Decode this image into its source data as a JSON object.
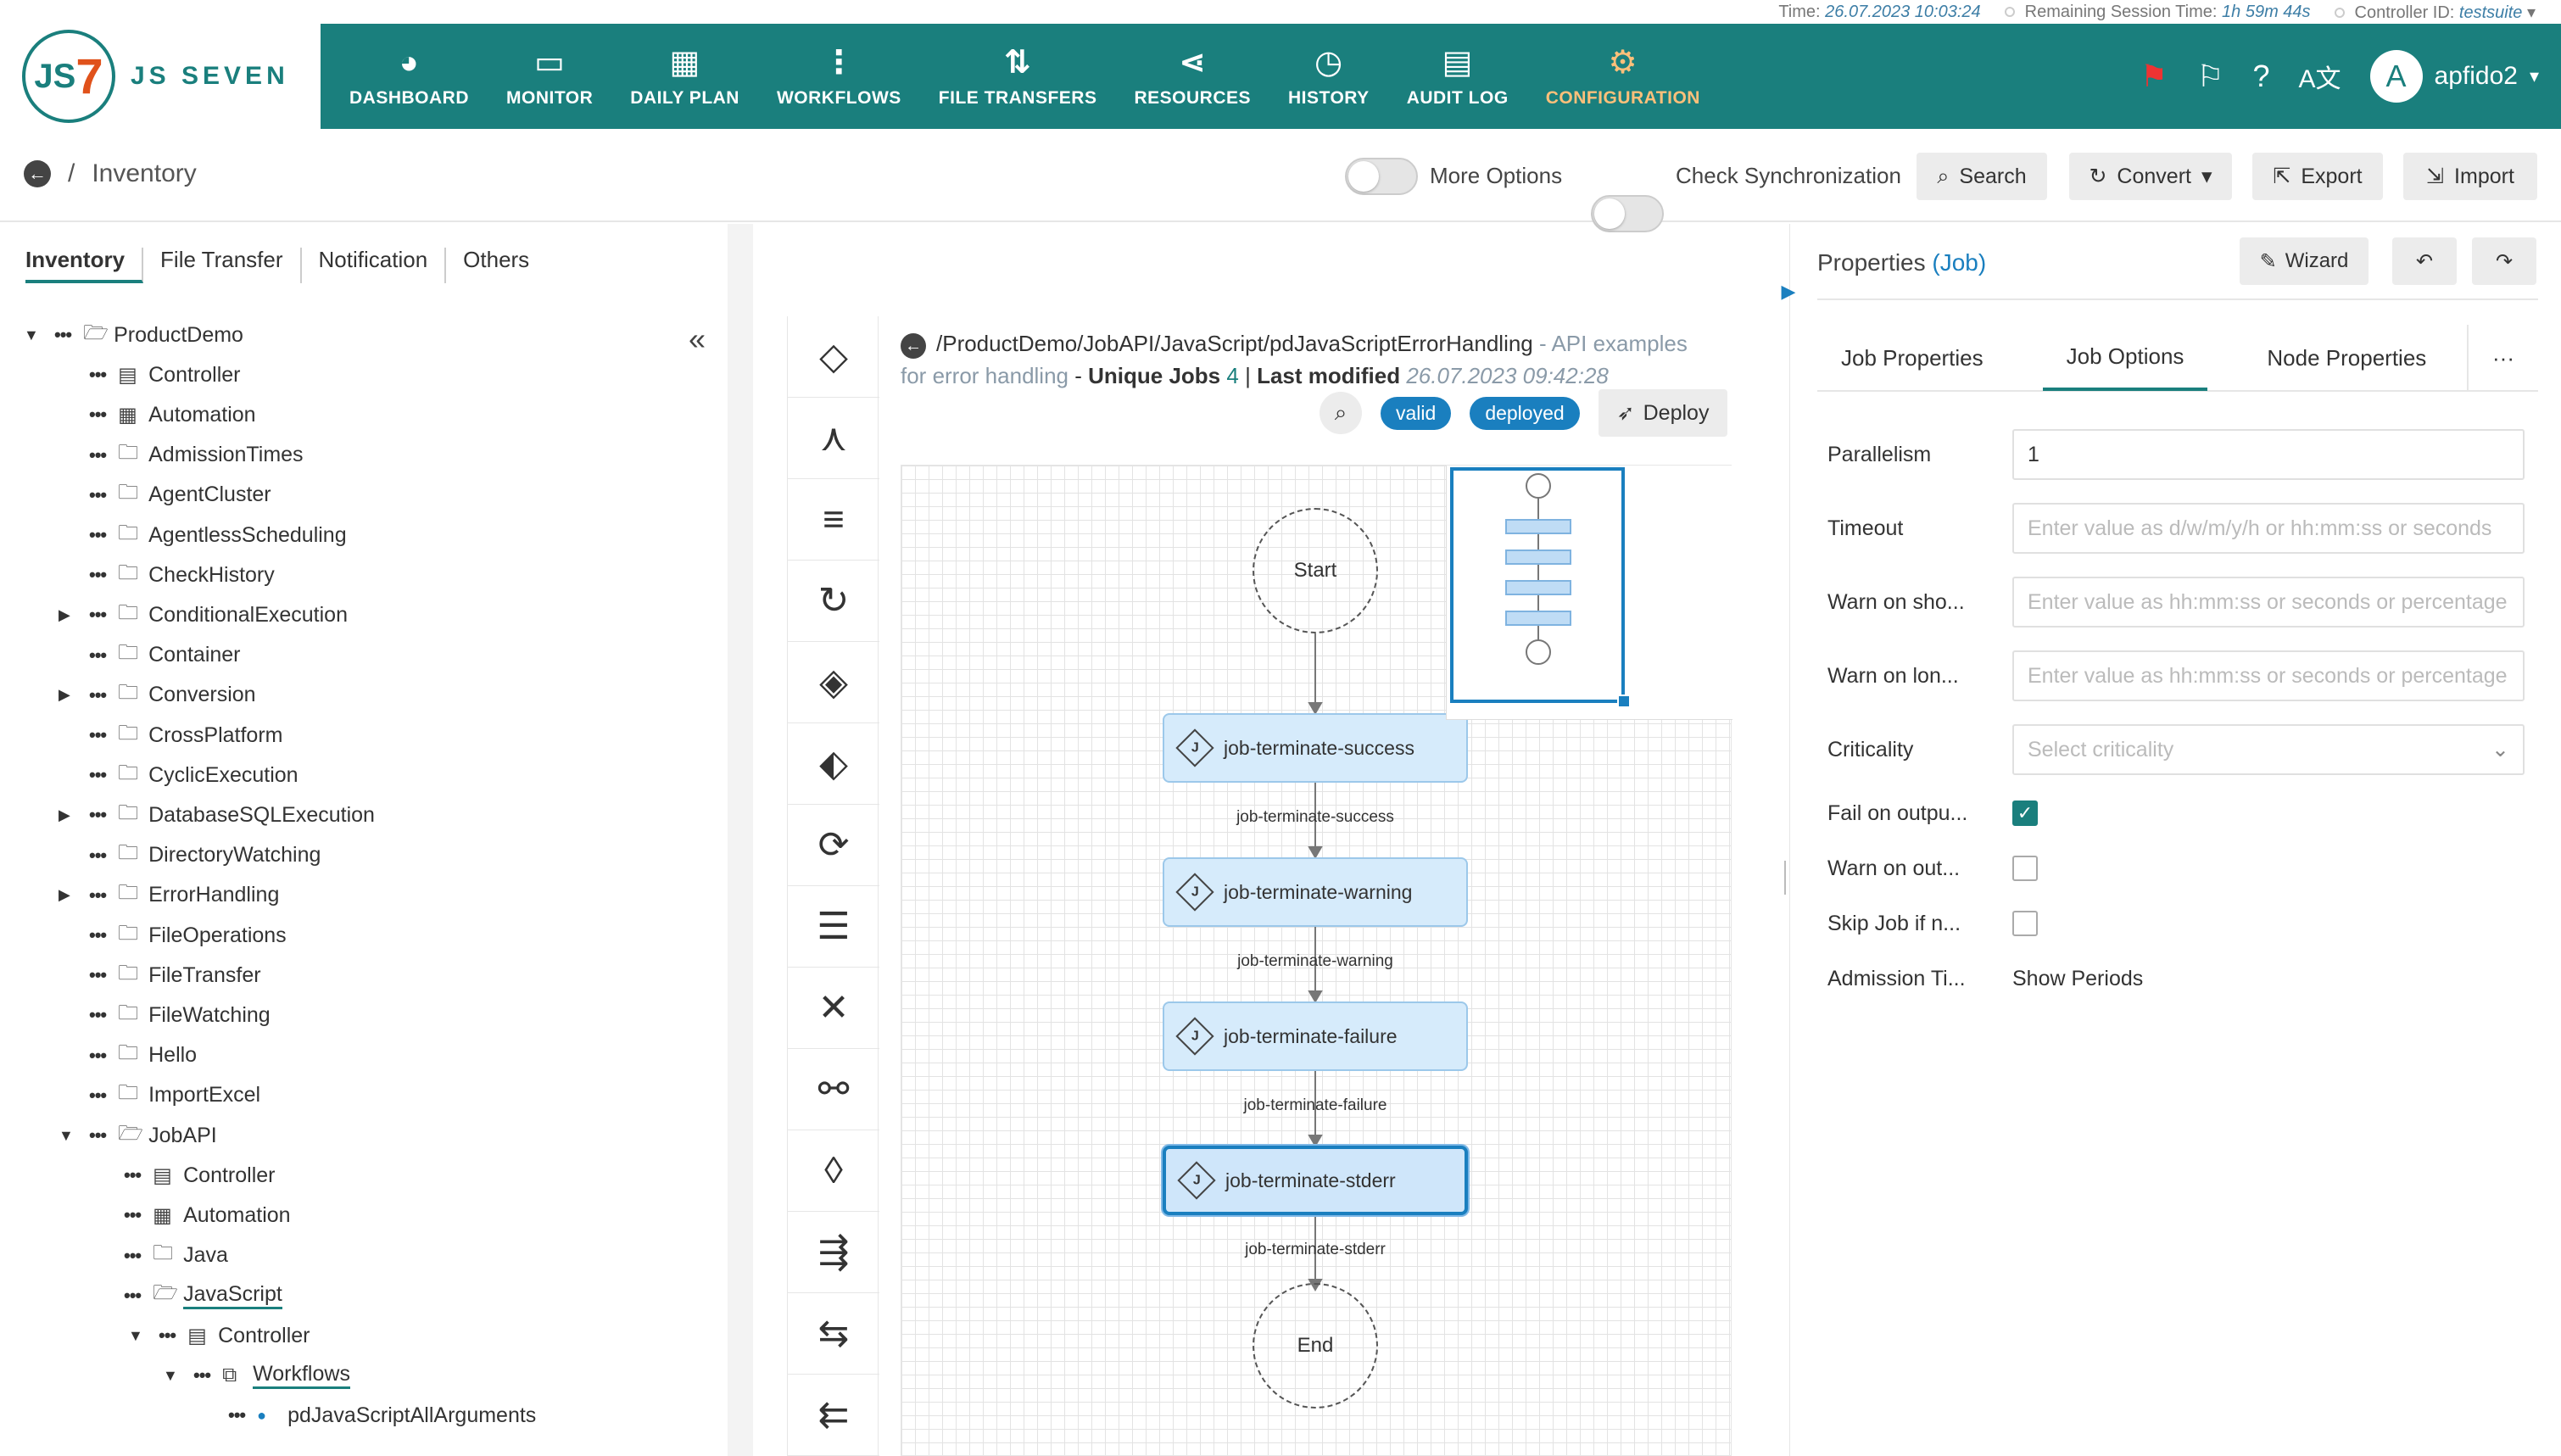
{
  "status_bar": {
    "time_label": "Time:",
    "time_value": "26.07.2023 10:03:24",
    "session_label": "Remaining Session Time:",
    "session_value": "1h 59m 44s",
    "controller_label": "Controller ID:",
    "controller_value": "testsuite"
  },
  "header": {
    "logo_text": "JS SEVEN",
    "logo_mark": "JS",
    "nav": [
      {
        "label": "DASHBOARD",
        "icon": "dashboard-icon",
        "glyph": "◕"
      },
      {
        "label": "MONITOR",
        "icon": "monitor-icon",
        "glyph": "▭"
      },
      {
        "label": "DAILY PLAN",
        "icon": "calendar-clock-icon",
        "glyph": "▦"
      },
      {
        "label": "WORKFLOWS",
        "icon": "workflow-icon",
        "glyph": "⋮"
      },
      {
        "label": "FILE TRANSFERS",
        "icon": "transfer-icon",
        "glyph": "⇅"
      },
      {
        "label": "RESOURCES",
        "icon": "share-icon",
        "glyph": "⋖"
      },
      {
        "label": "HISTORY",
        "icon": "alarm-icon",
        "glyph": "◷"
      },
      {
        "label": "AUDIT LOG",
        "icon": "file-search-icon",
        "glyph": "▤"
      },
      {
        "label": "CONFIGURATION",
        "icon": "gear-icon",
        "glyph": "⚙",
        "active": true
      }
    ],
    "user_initial": "A",
    "user_name": "apfido2"
  },
  "toolbar": {
    "breadcrumb": "Inventory",
    "more_options": "More Options",
    "check_sync": "Check Synchronization",
    "search": "Search",
    "convert": "Convert",
    "export": "Export",
    "import": "Import"
  },
  "left_tabs": [
    "Inventory",
    "File Transfer",
    "Notification",
    "Others"
  ],
  "tree": [
    {
      "label": "ProductDemo",
      "icon": "folder-open",
      "level": 0,
      "toggle": "▼"
    },
    {
      "label": "Controller",
      "icon": "doc",
      "level": 1,
      "toggle": ""
    },
    {
      "label": "Automation",
      "icon": "calendar",
      "level": 1,
      "toggle": ""
    },
    {
      "label": "AdmissionTimes",
      "icon": "folder",
      "level": 1,
      "toggle": ""
    },
    {
      "label": "AgentCluster",
      "icon": "folder",
      "level": 1,
      "toggle": ""
    },
    {
      "label": "AgentlessScheduling",
      "icon": "folder",
      "level": 1,
      "toggle": ""
    },
    {
      "label": "CheckHistory",
      "icon": "folder",
      "level": 1,
      "toggle": ""
    },
    {
      "label": "ConditionalExecution",
      "icon": "folder",
      "level": 1,
      "toggle": "▶"
    },
    {
      "label": "Container",
      "icon": "folder",
      "level": 1,
      "toggle": ""
    },
    {
      "label": "Conversion",
      "icon": "folder",
      "level": 1,
      "toggle": "▶"
    },
    {
      "label": "CrossPlatform",
      "icon": "folder",
      "level": 1,
      "toggle": ""
    },
    {
      "label": "CyclicExecution",
      "icon": "folder",
      "level": 1,
      "toggle": ""
    },
    {
      "label": "DatabaseSQLExecution",
      "icon": "folder",
      "level": 1,
      "toggle": "▶"
    },
    {
      "label": "DirectoryWatching",
      "icon": "folder",
      "level": 1,
      "toggle": ""
    },
    {
      "label": "ErrorHandling",
      "icon": "folder",
      "level": 1,
      "toggle": "▶"
    },
    {
      "label": "FileOperations",
      "icon": "folder",
      "level": 1,
      "toggle": ""
    },
    {
      "label": "FileTransfer",
      "icon": "folder",
      "level": 1,
      "toggle": ""
    },
    {
      "label": "FileWatching",
      "icon": "folder",
      "level": 1,
      "toggle": ""
    },
    {
      "label": "Hello",
      "icon": "folder",
      "level": 1,
      "toggle": ""
    },
    {
      "label": "ImportExcel",
      "icon": "folder",
      "level": 1,
      "toggle": ""
    },
    {
      "label": "JobAPI",
      "icon": "folder-open",
      "level": 1,
      "toggle": "▼"
    },
    {
      "label": "Controller",
      "icon": "doc",
      "level": 2,
      "toggle": ""
    },
    {
      "label": "Automation",
      "icon": "calendar",
      "level": 2,
      "toggle": ""
    },
    {
      "label": "Java",
      "icon": "folder",
      "level": 2,
      "toggle": ""
    },
    {
      "label": "JavaScript",
      "icon": "folder-open",
      "level": 2,
      "toggle": "",
      "selected": true
    },
    {
      "label": "Controller",
      "icon": "doc",
      "level": 3,
      "toggle": "▼"
    },
    {
      "label": "Workflows",
      "icon": "workflow",
      "level": 4,
      "toggle": "▼",
      "selected": true
    },
    {
      "label": "pdJavaScriptAllArguments",
      "icon": "dot",
      "level": 5,
      "toggle": ""
    }
  ],
  "workflow": {
    "path": "/ProductDemo/JobAPI/JavaScript/pdJavaScriptErrorHandling",
    "title": "API examples for error handling",
    "unique_jobs_label": "Unique Jobs",
    "unique_jobs_count": "4",
    "last_modified_label": "Last modified",
    "last_modified_value": "26.07.2023 09:42:28",
    "badge_valid": "valid",
    "badge_deployed": "deployed",
    "deploy_label": "Deploy",
    "start_label": "Start",
    "end_label": "End",
    "jobs": [
      {
        "name": "job-terminate-success",
        "edge": "job-terminate-success"
      },
      {
        "name": "job-terminate-warning",
        "edge": "job-terminate-warning"
      },
      {
        "name": "job-terminate-failure",
        "edge": "job-terminate-failure"
      },
      {
        "name": "job-terminate-stderr",
        "edge": "job-terminate-stderr",
        "selected": true
      }
    ]
  },
  "palette": [
    {
      "name": "job-instruction",
      "glyph": "◇"
    },
    {
      "name": "fork-instruction",
      "glyph": "⋏"
    },
    {
      "name": "fork-list-instruction",
      "glyph": "≡"
    },
    {
      "name": "retry-instruction",
      "glyph": "↻"
    },
    {
      "name": "if-instruction",
      "glyph": "◈"
    },
    {
      "name": "try-instruction",
      "glyph": "⬖"
    },
    {
      "name": "cycle-instruction",
      "glyph": "⟳"
    },
    {
      "name": "finish-instruction",
      "glyph": "☰"
    },
    {
      "name": "fail-instruction",
      "glyph": "✕"
    },
    {
      "name": "lock-instruction",
      "glyph": "⚯"
    },
    {
      "name": "prompt-instruction",
      "glyph": "◊"
    },
    {
      "name": "post-notice-instruction",
      "glyph": "⇶"
    },
    {
      "name": "expect-notice-instruction",
      "glyph": "⇆"
    },
    {
      "name": "consume-notice-instruction",
      "glyph": "⇇"
    }
  ],
  "properties": {
    "title": "Properties",
    "title_type": "(Job)",
    "wizard": "Wizard",
    "tabs": [
      "Job Properties",
      "Job Options",
      "Node Properties"
    ],
    "more_tab": "···",
    "fields": {
      "parallelism_label": "Parallelism",
      "parallelism_value": "1",
      "timeout_label": "Timeout",
      "timeout_placeholder": "Enter value as d/w/m/y/h or hh:mm:ss or seconds",
      "warn_short_label": "Warn on sho...",
      "warn_short_placeholder": "Enter value as hh:mm:ss or seconds or percentage",
      "warn_long_label": "Warn on lon...",
      "warn_long_placeholder": "Enter value as hh:mm:ss or seconds or percentage",
      "criticality_label": "Criticality",
      "criticality_placeholder": "Select criticality",
      "fail_output_label": "Fail on outpu...",
      "fail_output_checked": true,
      "warn_output_label": "Warn on out...",
      "warn_output_checked": false,
      "skip_job_label": "Skip Job if n...",
      "skip_job_checked": false,
      "admission_label": "Admission Ti...",
      "admission_value": "Show Periods"
    }
  },
  "colors": {
    "header_teal": "#1a7f7d",
    "accent_blue": "#1a7fbf",
    "active_nav": "#ffc07a",
    "node_fill": "#d6ebfb"
  }
}
